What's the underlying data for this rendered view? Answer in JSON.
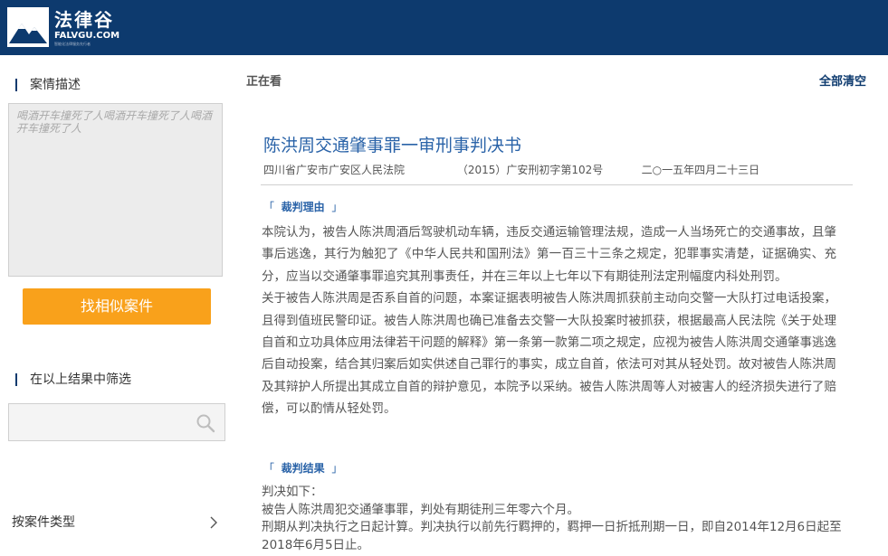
{
  "header": {
    "logo_name": "法律谷",
    "logo_domain": "FALVGU.COM",
    "logo_tagline": "智能化法律服务先行者",
    "brand_color": "#0d3a6e"
  },
  "sidebar": {
    "case_desc_title": "案情描述",
    "case_desc_text": "喝酒开车撞死了人喝酒开车撞死了人喝酒开车撞死了人",
    "find_similar_label": "找相似案件",
    "filter_title": "在以上结果中筛选",
    "filter_placeholder": "",
    "case_type_label": "按案件类型",
    "accent_color": "#f9a11b"
  },
  "main": {
    "viewing_label": "正在看",
    "clear_all_label": "全部清空",
    "doc": {
      "title": "陈洪周交通肇事罪一审刑事判决书",
      "court": "四川省广安市广安区人民法院",
      "case_no": "（2015）广安刑初字第102号",
      "date": "二○一五年四月二十三日"
    },
    "reasoning": {
      "label": "裁判理由",
      "bracket_open": "「",
      "bracket_close": "」",
      "paragraphs": [
        "本院认为，被告人陈洪周酒后驾驶机动车辆，违反交通运输管理法规，造成一人当场死亡的交通事故，且肇事后逃逸，其行为触犯了《中华人民共和国刑法》第一百三十三条之规定，犯罪事实清楚，证据确实、充分，应当以交通肇事罪追究其刑事责任，并在三年以上七年以下有期徒刑法定刑幅度内科处刑罚。",
        "关于被告人陈洪周是否系自首的问题，本案证据表明被告人陈洪周抓获前主动向交警一大队打过电话投案，且得到值班民警印证。被告人陈洪周也确已准备去交警一大队投案时被抓获，根据最高人民法院《关于处理自首和立功具体应用法律若干问题的解释》第一条第一款第二项之规定，应视为被告人陈洪周交通肇事逃逸后自动投案，结合其归案后如实供述自己罪行的事实，成立自首，依法可对其从轻处罚。故对被告人陈洪周及其辩护人所提出其成立自首的辩护意见，本院予以采纳。被告人陈洪周等人对被害人的经济损失进行了赔偿，可以酌情从轻处罚。"
      ]
    },
    "result": {
      "label": "裁判结果",
      "bracket_open": "「",
      "bracket_close": "」",
      "lines": [
        "判决如下：",
        "被告人陈洪周犯交通肇事罪，判处有期徒刑三年零六个月。",
        "刑期从判决执行之日起计算。判决执行以前先行羁押的，羁押一日折抵刑期一日，即自2014年12月6日起至2018年6月5日止。"
      ]
    }
  }
}
